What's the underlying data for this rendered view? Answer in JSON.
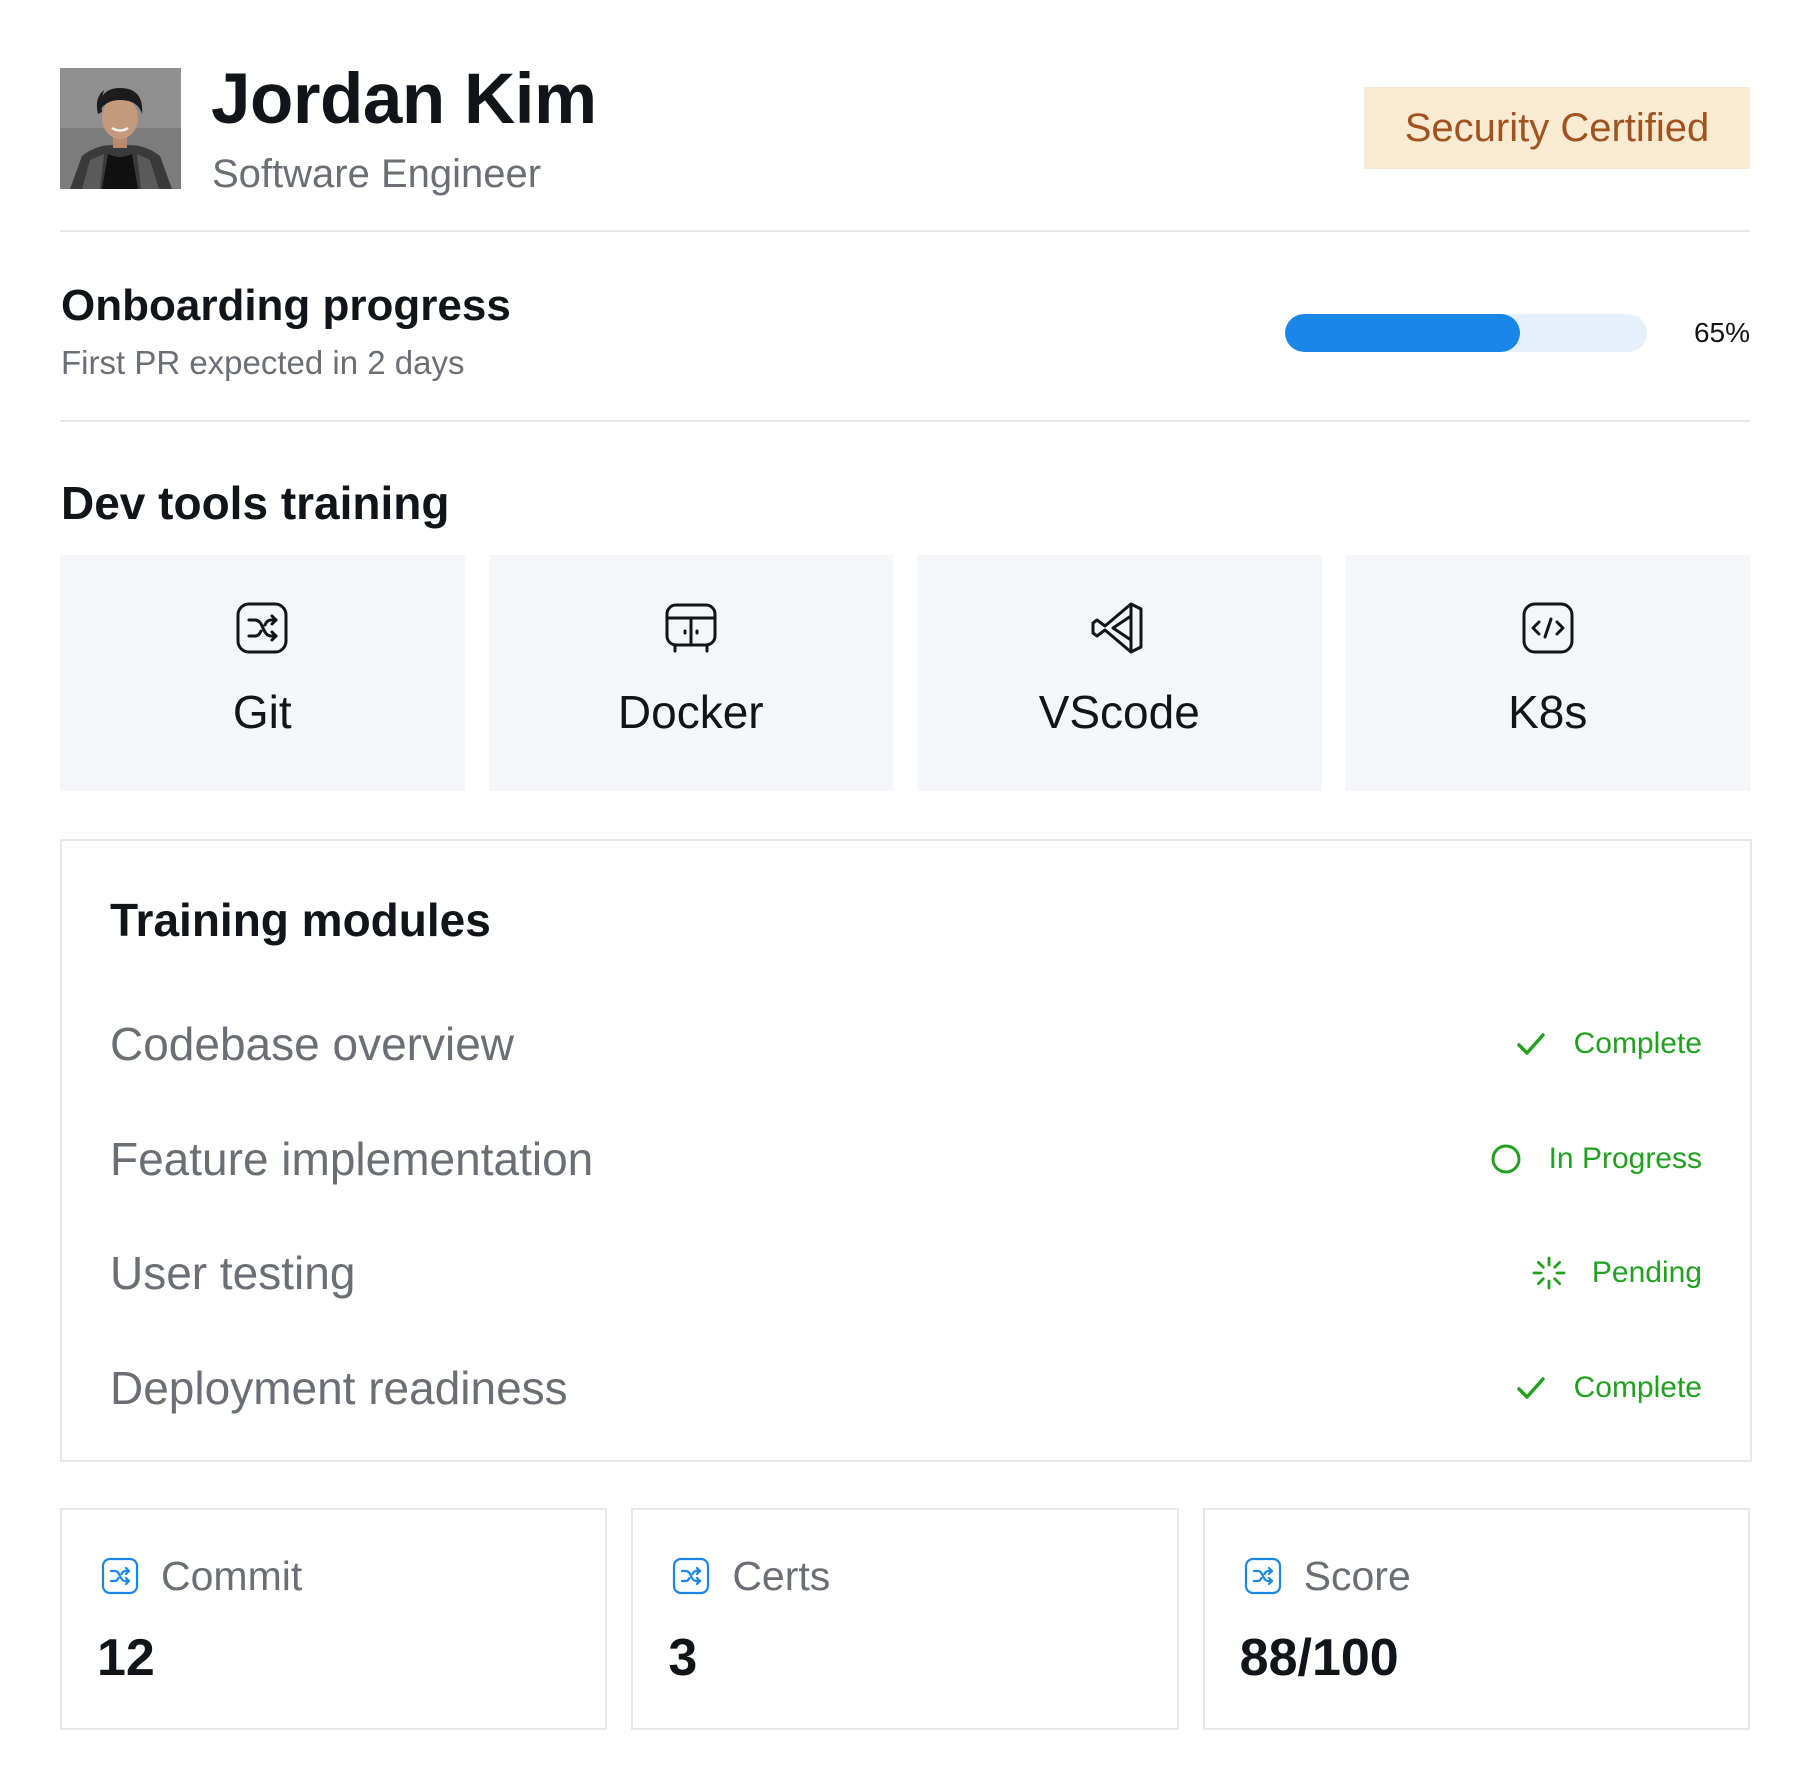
{
  "profile": {
    "name": "Jordan Kim",
    "role": "Software Engineer",
    "badge": "Security Certified",
    "avatar_icon": "person-photo"
  },
  "onboarding": {
    "title": "Onboarding progress",
    "subtitle": "First PR expected in 2 days",
    "progress_percent": 65,
    "progress_label": "65%"
  },
  "dev_tools": {
    "title": "Dev tools training",
    "items": [
      {
        "label": "Git",
        "icon": "git-shuffle-icon"
      },
      {
        "label": "Docker",
        "icon": "docker-container-icon"
      },
      {
        "label": "VScode",
        "icon": "vscode-icon"
      },
      {
        "label": "K8s",
        "icon": "code-brackets-icon"
      }
    ]
  },
  "modules": {
    "title": "Training modules",
    "items": [
      {
        "name": "Codebase overview",
        "status": "Complete",
        "status_icon": "check-icon"
      },
      {
        "name": "Feature implementation",
        "status": "In Progress",
        "status_icon": "circle-icon"
      },
      {
        "name": "User testing",
        "status": "Pending",
        "status_icon": "loader-icon"
      },
      {
        "name": "Deployment readiness",
        "status": "Complete",
        "status_icon": "check-icon"
      }
    ]
  },
  "stats": [
    {
      "label": "Commit",
      "value": "12",
      "icon": "shuffle-icon"
    },
    {
      "label": "Certs",
      "value": "3",
      "icon": "shuffle-icon"
    },
    {
      "label": "Score",
      "value": "88/100",
      "icon": "shuffle-icon"
    }
  ],
  "colors": {
    "accent_blue": "#1a86e8",
    "progress_track": "#e6f0fb",
    "status_green": "#22a020",
    "badge_bg": "#f9ead2",
    "badge_text": "#a0521f",
    "card_bg": "#f4f6fa",
    "border": "#e6e8eb"
  }
}
